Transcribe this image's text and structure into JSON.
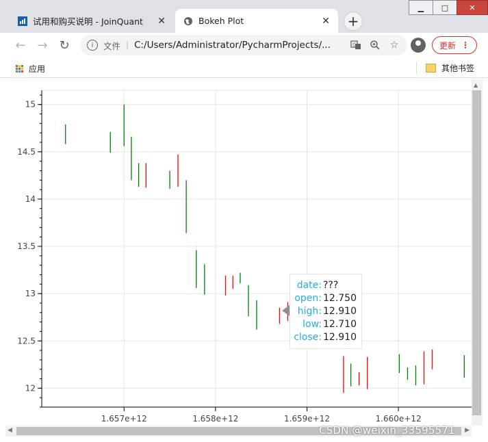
{
  "tabs": [
    {
      "title": "试用和购买说明 - JoinQuant",
      "active": false
    },
    {
      "title": "Bokeh Plot",
      "active": true
    }
  ],
  "toolbar": {
    "scheme_label": "文件",
    "url": "C:/Users/Administrator/PycharmProjects/...",
    "update_label": "更新"
  },
  "bookmarks": {
    "apps_label": "应用",
    "other_label": "其他书签"
  },
  "watermark": "CSDN @weixin_33595571",
  "tooltip": {
    "rows": [
      {
        "key": "date:",
        "value": "???"
      },
      {
        "key": "open:",
        "value": "12.750"
      },
      {
        "key": "high:",
        "value": "12.910"
      },
      {
        "key": "low:",
        "value": "12.710"
      },
      {
        "key": "close:",
        "value": "12.910"
      }
    ]
  },
  "colors": {
    "up": "#ff0000",
    "down": "#008000",
    "tooltip_key": "#26aae1"
  },
  "chart_data": {
    "type": "ohlc",
    "x_tick_labels": [
      "1.657e+12",
      "1.658e+12",
      "1.659e+12",
      "1.660e+12"
    ],
    "x_ticks": [
      1657000000000.0,
      1658000000000.0,
      1659000000000.0,
      1660000000000.0
    ],
    "y_tick_labels": [
      "12",
      "12.5",
      "13",
      "13.5",
      "14",
      "14.5",
      "15"
    ],
    "y_ticks": [
      12,
      12.5,
      13,
      13.5,
      14,
      14.5,
      15
    ],
    "xlim": [
      1656100000000.0,
      1660800000000.0
    ],
    "ylim": [
      11.8,
      15.15
    ],
    "grid": true,
    "bars": [
      {
        "x": 1656360000000.0,
        "low": 14.58,
        "high": 14.79,
        "color": "green"
      },
      {
        "x": 1656850000000.0,
        "low": 14.49,
        "high": 14.71,
        "color": "green"
      },
      {
        "x": 1657000000000.0,
        "low": 14.56,
        "high": 15.0,
        "color": "green"
      },
      {
        "x": 1657080000000.0,
        "low": 14.2,
        "high": 14.66,
        "color": "green"
      },
      {
        "x": 1657160000000.0,
        "low": 14.13,
        "high": 14.38,
        "color": "green"
      },
      {
        "x": 1657240000000.0,
        "low": 14.12,
        "high": 14.38,
        "color": "red"
      },
      {
        "x": 1657500000000.0,
        "low": 14.11,
        "high": 14.3,
        "color": "green"
      },
      {
        "x": 1657590000000.0,
        "low": 14.13,
        "high": 14.47,
        "color": "red"
      },
      {
        "x": 1657680000000.0,
        "low": 13.64,
        "high": 14.2,
        "color": "green"
      },
      {
        "x": 1657790000000.0,
        "low": 13.06,
        "high": 13.46,
        "color": "green"
      },
      {
        "x": 1657880000000.0,
        "low": 12.99,
        "high": 13.31,
        "color": "green"
      },
      {
        "x": 1658110000000.0,
        "low": 12.98,
        "high": 13.19,
        "color": "red"
      },
      {
        "x": 1658190000000.0,
        "low": 13.05,
        "high": 13.19,
        "color": "red"
      },
      {
        "x": 1658270000000.0,
        "low": 13.11,
        "high": 13.22,
        "color": "green"
      },
      {
        "x": 1658360000000.0,
        "low": 12.76,
        "high": 13.09,
        "color": "green"
      },
      {
        "x": 1658450000000.0,
        "low": 12.62,
        "high": 12.93,
        "color": "green"
      },
      {
        "x": 1658700000000.0,
        "low": 12.68,
        "high": 12.85,
        "color": "red"
      },
      {
        "x": 1658790000000.0,
        "low": 12.71,
        "high": 12.91,
        "color": "red"
      },
      {
        "x": 1658880000000.0,
        "low": 12.73,
        "high": 12.86,
        "color": "green"
      },
      {
        "x": 1659250000000.0,
        "low": 12.42,
        "high": 12.5,
        "color": "green"
      },
      {
        "x": 1659400000000.0,
        "low": 11.95,
        "high": 12.34,
        "color": "red"
      },
      {
        "x": 1659480000000.0,
        "low": 12.02,
        "high": 12.26,
        "color": "green"
      },
      {
        "x": 1659570000000.0,
        "low": 12.03,
        "high": 12.17,
        "color": "red"
      },
      {
        "x": 1659660000000.0,
        "low": 11.99,
        "high": 12.33,
        "color": "red"
      },
      {
        "x": 1660010000000.0,
        "low": 12.16,
        "high": 12.36,
        "color": "green"
      },
      {
        "x": 1660100000000.0,
        "low": 12.09,
        "high": 12.22,
        "color": "green"
      },
      {
        "x": 1660190000000.0,
        "low": 12.03,
        "high": 12.24,
        "color": "green"
      },
      {
        "x": 1660280000000.0,
        "low": 12.04,
        "high": 12.39,
        "color": "red"
      },
      {
        "x": 1660370000000.0,
        "low": 12.2,
        "high": 12.41,
        "color": "red"
      },
      {
        "x": 1660720000000.0,
        "low": 12.11,
        "high": 12.35,
        "color": "green"
      },
      {
        "x": 1660810000000.0,
        "low": 12.1,
        "high": 12.2,
        "color": "red"
      },
      {
        "x": 1660890000000.0,
        "low": 12.06,
        "high": 12.42,
        "color": "red"
      },
      {
        "x": 1660980000000.0,
        "low": 12.17,
        "high": 12.54,
        "color": "green"
      }
    ]
  }
}
